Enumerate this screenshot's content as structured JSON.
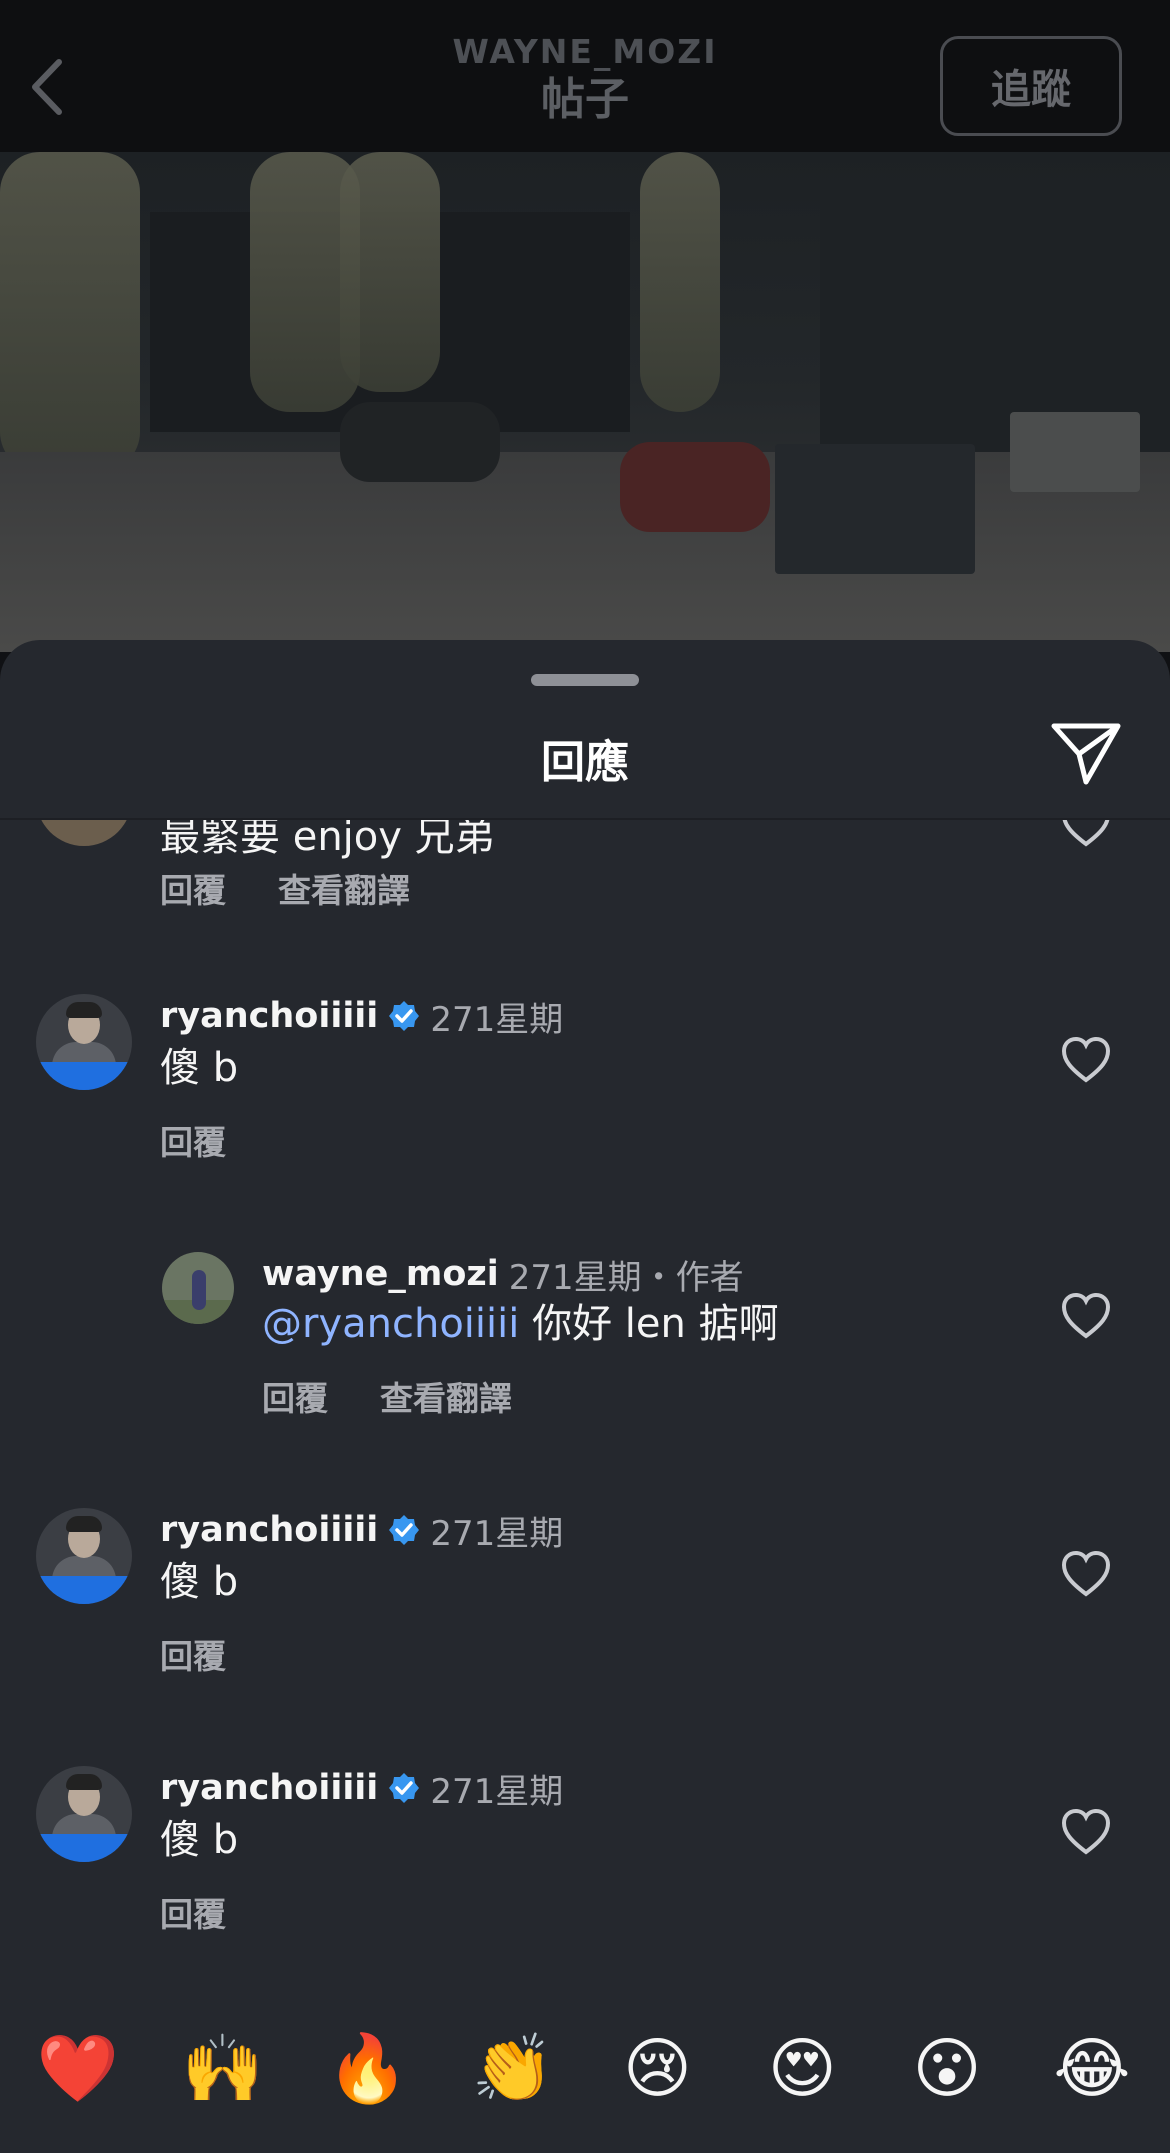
{
  "header": {
    "username": "WAYNE_MOZI",
    "subtitle": "帖子",
    "follow_label": "追蹤"
  },
  "sheet": {
    "title": "回應",
    "partial_comment_text": "最緊要 enjoy 兄弟",
    "partial_actions": [
      "回覆",
      "查看翻譯"
    ]
  },
  "comments": [
    {
      "username": "ryanchoiiiii",
      "verified": true,
      "time": "271星期",
      "text": "傻 b",
      "reply_label": "回覆"
    },
    {
      "username": "wayne_mozi",
      "verified": false,
      "time": "271星期",
      "author_label": "・作者",
      "mention": "@ryanchoiiiii",
      "text": " 你好 len 掂啊",
      "reply_label": "回覆",
      "translate_label": "查看翻譯"
    },
    {
      "username": "ryanchoiiiii",
      "verified": true,
      "time": "271星期",
      "text": "傻 b",
      "reply_label": "回覆"
    },
    {
      "username": "ryanchoiiiii",
      "verified": true,
      "time": "271星期",
      "text": "傻 b",
      "reply_label": "回覆"
    }
  ],
  "emoji_bar": [
    {
      "name": "red-heart",
      "glyph": "❤️"
    },
    {
      "name": "raising-hands",
      "glyph": "🙌"
    },
    {
      "name": "fire",
      "glyph": "🔥"
    },
    {
      "name": "clapping-hands",
      "glyph": "👏"
    },
    {
      "name": "crying-face",
      "glyph": "😢"
    },
    {
      "name": "heart-eyes",
      "glyph": "😍"
    },
    {
      "name": "surprised-face",
      "glyph": "😮"
    },
    {
      "name": "tears-of-joy",
      "glyph": "😂"
    }
  ],
  "colors": {
    "sheet_bg": "#25282e",
    "mention": "#8fb4ff",
    "verified": "#3897f0",
    "muted_text": "#a8aab0"
  }
}
